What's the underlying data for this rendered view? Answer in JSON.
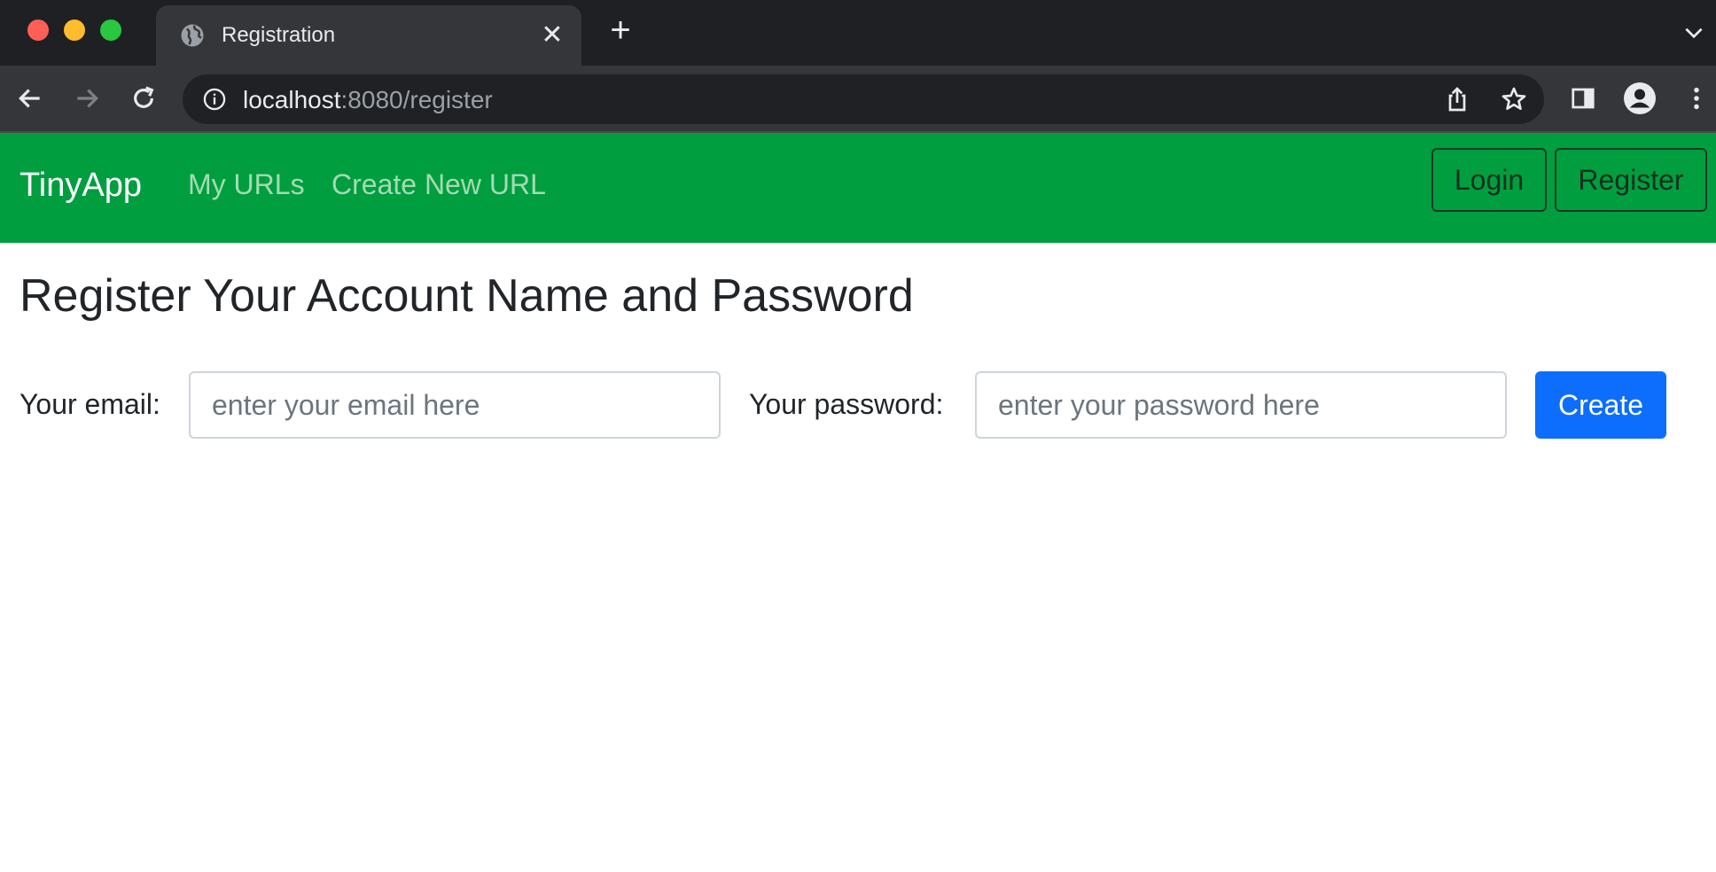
{
  "browser": {
    "tab_title": "Registration",
    "new_tab_symbol": "+",
    "close_symbol": "✕",
    "url_host": "localhost",
    "url_path": ":8080/register"
  },
  "navbar": {
    "brand": "TinyApp",
    "links": [
      "My URLs",
      "Create New URL"
    ],
    "login_label": "Login",
    "register_label": "Register",
    "bg_color": "#009e3f"
  },
  "main": {
    "title": "Register Your Account Name and Password",
    "email_label": "Your email:",
    "email_placeholder": "enter your email here",
    "password_label": "Your password:",
    "password_placeholder": "enter your password here",
    "submit_label": "Create",
    "submit_color": "#0d6efd"
  }
}
